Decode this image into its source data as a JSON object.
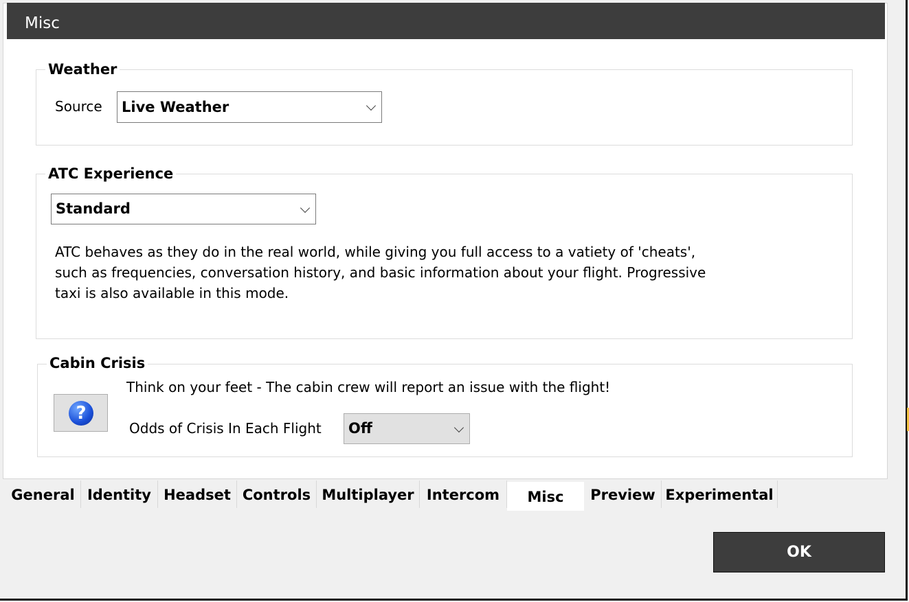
{
  "header": {
    "title": "Misc"
  },
  "weather": {
    "group_title": "Weather",
    "source_label": "Source",
    "source_value": "Live Weather"
  },
  "atc": {
    "group_title": "ATC Experience",
    "mode_value": "Standard",
    "description_lines": [
      "ATC behaves as they do in the real world, while giving you full access to a vatiety of 'cheats',",
      "such as frequencies, conversation history, and basic information about your flight. Progressive",
      "taxi is also available in this mode."
    ]
  },
  "cabin": {
    "group_title": "Cabin Crisis",
    "description": "Think on your feet - The cabin crew will report an issue with the flight!",
    "help_icon_glyph": "?",
    "odds_label": "Odds of Crisis In Each Flight",
    "odds_value": "Off"
  },
  "tabs": [
    {
      "label": "General"
    },
    {
      "label": "Identity"
    },
    {
      "label": "Headset"
    },
    {
      "label": "Controls"
    },
    {
      "label": "Multiplayer"
    },
    {
      "label": "Intercom"
    },
    {
      "label": "Misc",
      "active": true
    },
    {
      "label": "Preview"
    },
    {
      "label": "Experimental"
    }
  ],
  "footer": {
    "ok_label": "OK"
  },
  "colors": {
    "header_bg": "#3d3d3d",
    "help_icon": "#1a4fd8"
  }
}
